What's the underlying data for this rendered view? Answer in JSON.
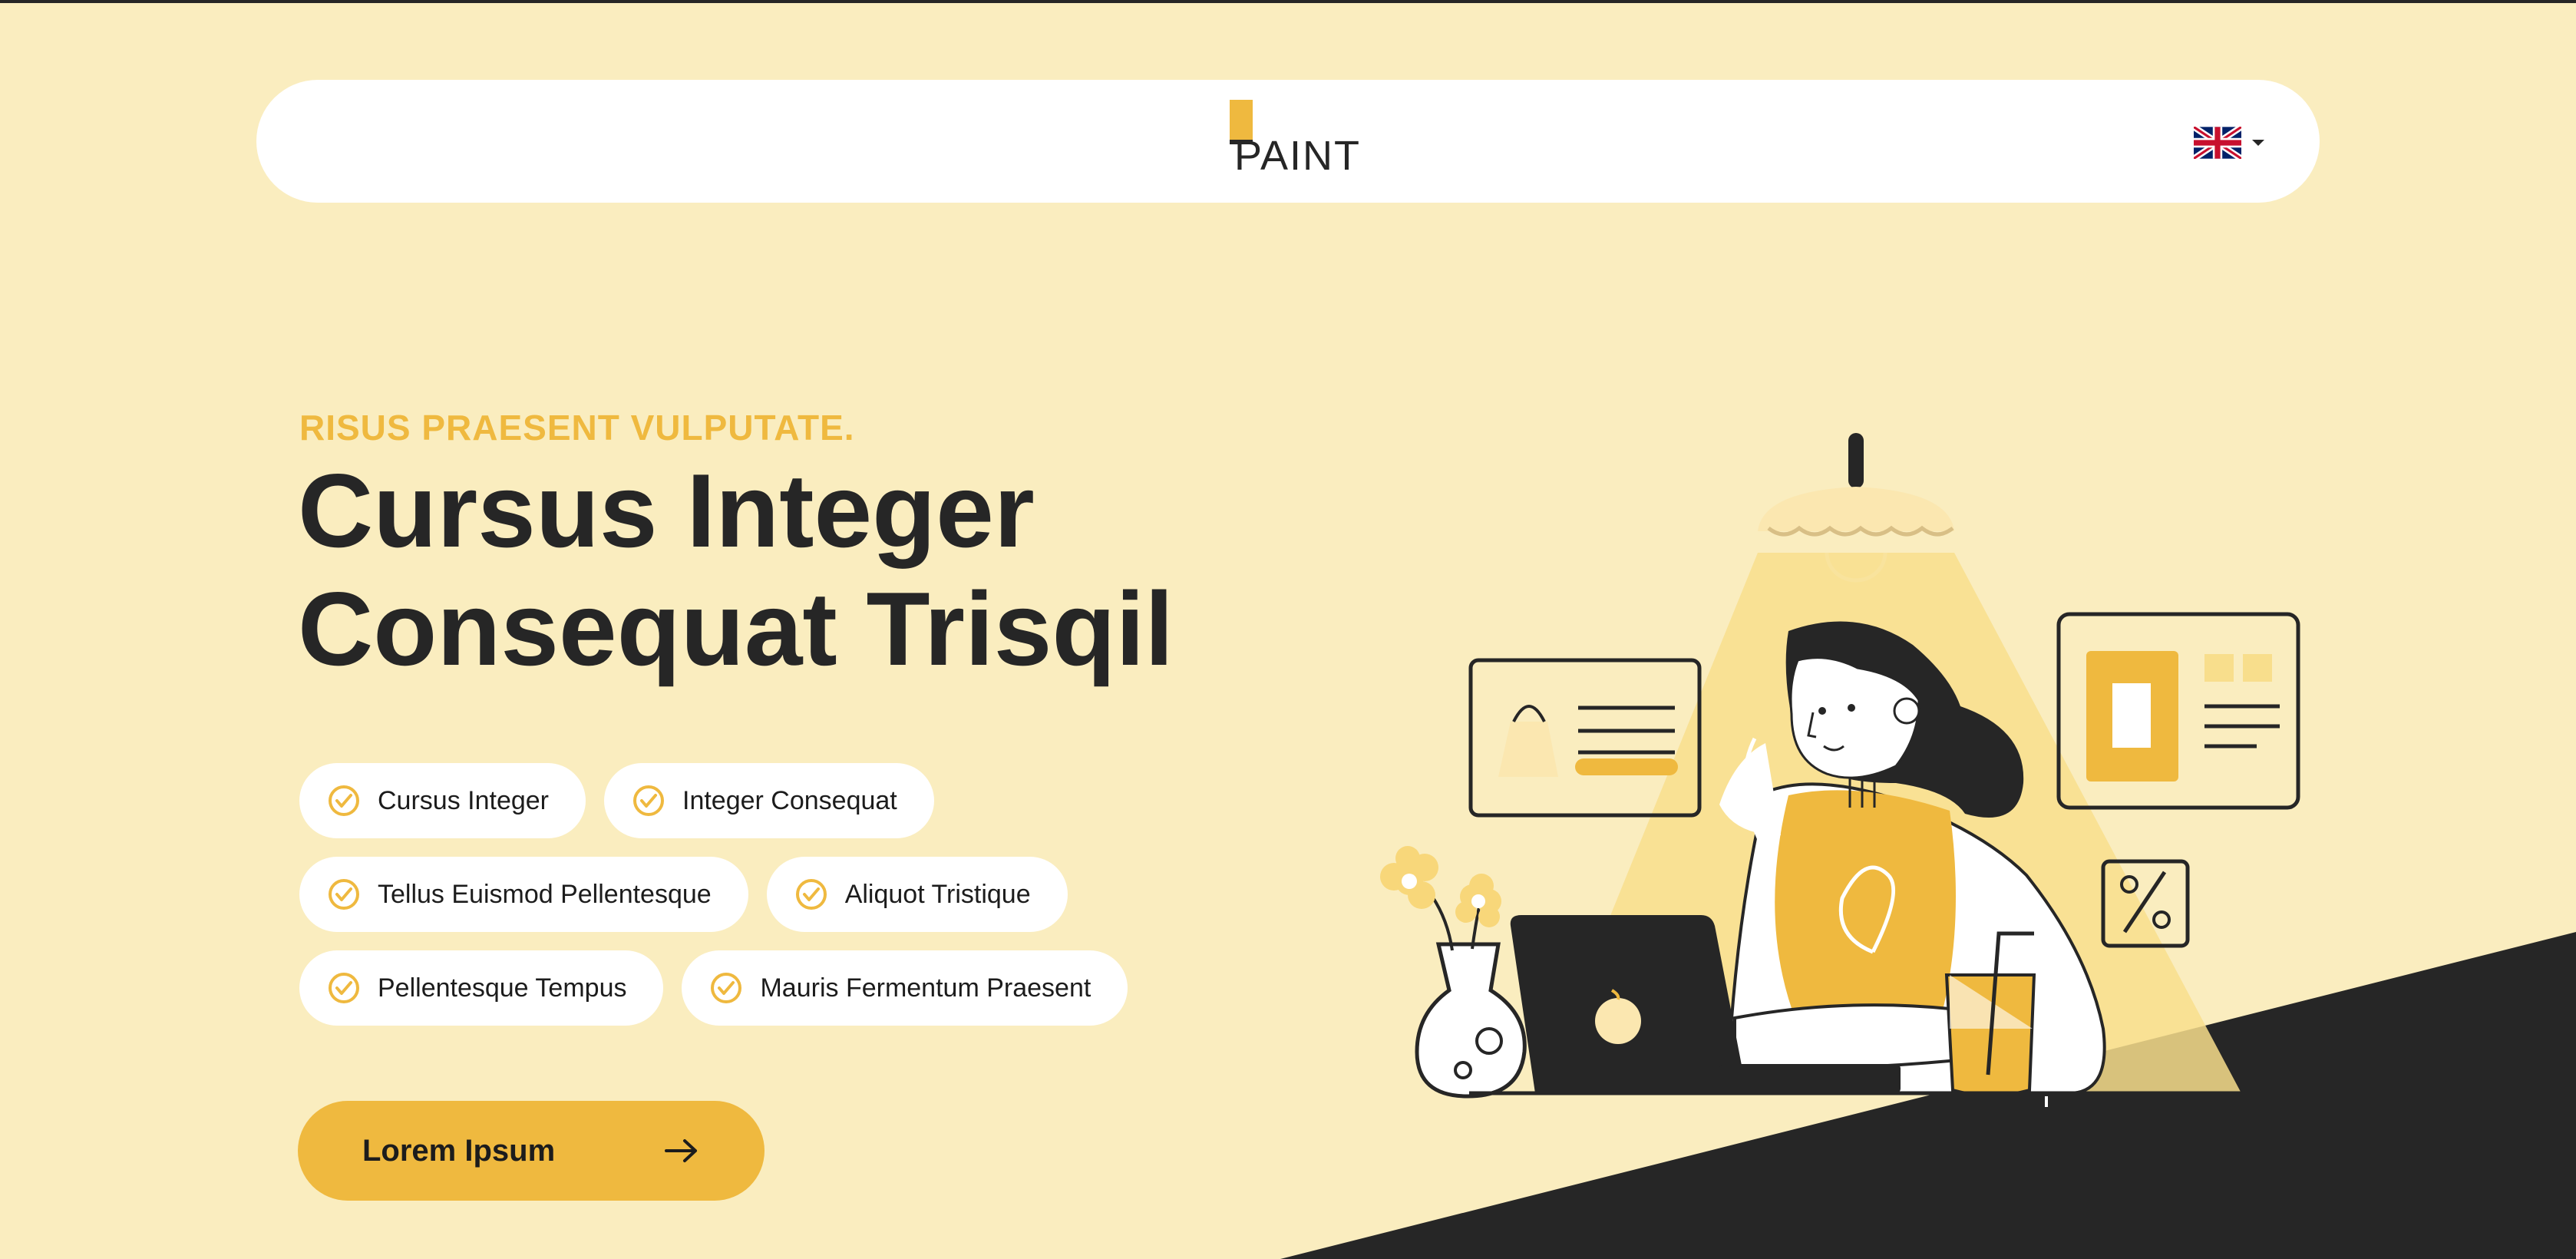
{
  "header": {
    "logo_text": "PAINT",
    "language_flag": "uk-flag-icon",
    "language_menu_icon": "caret-down-icon"
  },
  "hero": {
    "eyebrow": "RISUS PRAESENT VULPUTATE.",
    "headline_line1": "Cursus Integer",
    "headline_line2": "Consequat Trisqil",
    "features": [
      "Cursus Integer",
      "Integer Consequat",
      "Tellus Euismod Pellentesque",
      "Aliquot Tristique",
      "Pellentesque Tempus",
      "Mauris Fermentum Praesent"
    ],
    "cta_label": "Lorem Ipsum",
    "cta_icon": "arrow-right-icon"
  },
  "colors": {
    "background": "#faedbf",
    "accent": "#efb93f",
    "dark": "#262626",
    "white": "#ffffff"
  }
}
